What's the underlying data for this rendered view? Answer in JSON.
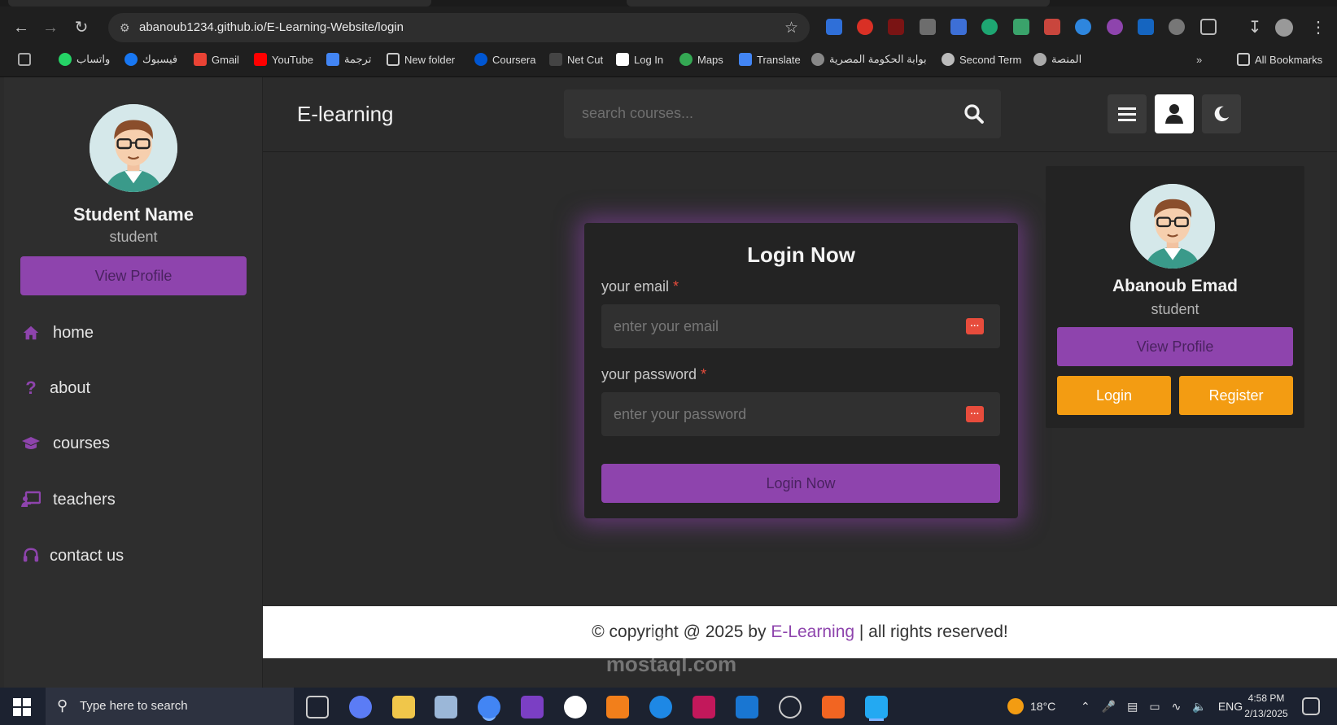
{
  "browser": {
    "url": "abanoub1234.github.io/E-Learning-Website/login",
    "bookmarks": [
      "واتساب",
      "فيسبوك",
      "Gmail",
      "YouTube",
      "ترجمة",
      "New folder",
      "Coursera",
      "Net Cut",
      "Log In",
      "Maps",
      "Translate",
      "بوابة الحكومة المصرية",
      "Second Term",
      "المنصة",
      "All Bookmarks"
    ]
  },
  "sidebar": {
    "name": "Student Name",
    "role": "student",
    "view_profile": "View Profile",
    "links": [
      {
        "label": "home",
        "icon": "home-icon"
      },
      {
        "label": "about",
        "icon": "question-icon"
      },
      {
        "label": "courses",
        "icon": "graduation-cap-icon"
      },
      {
        "label": "teachers",
        "icon": "chalkboard-teacher-icon"
      },
      {
        "label": "contact us",
        "icon": "headset-icon"
      }
    ]
  },
  "header": {
    "logo": "E-learning",
    "search_placeholder": "search courses...",
    "buttons": [
      "menu-icon",
      "user-icon",
      "moon-icon"
    ]
  },
  "login": {
    "title": "Login Now",
    "email_label": "your email",
    "email_placeholder": "enter your email",
    "password_label": "your password",
    "password_placeholder": "enter your password",
    "required_mark": "*",
    "submit": "Login Now"
  },
  "profile_popup": {
    "name": "Abanoub Emad",
    "role": "student",
    "view_profile": "View Profile",
    "login": "Login",
    "register": "Register"
  },
  "footer": {
    "prefix": "© copyright @ 2025 by ",
    "brand": "E-Learning",
    "suffix": " | all rights reserved!"
  },
  "taskbar": {
    "search_placeholder": "Type here to search",
    "weather": "18°C",
    "language": "ENG",
    "time": "4:58 PM",
    "date": "2/13/2025"
  },
  "colors": {
    "accent": "#8e44ad",
    "orange": "#f39c12",
    "dark_bg": "#2b2b2b",
    "card_bg": "#232323"
  },
  "watermark": "مستقل\nmostaql.com"
}
